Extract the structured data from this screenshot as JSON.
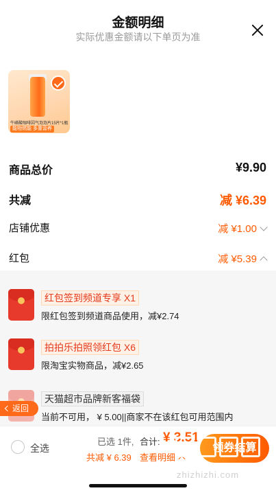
{
  "header": {
    "title": "金额明细",
    "subtitle": "实际优惠金额请以下单页为准"
  },
  "product": {
    "caption": "牛磺酸咖啡因气泡泡片15片*1瓶",
    "tag": "能物燃能 多重营养",
    "selected": true
  },
  "summary": {
    "total_label": "商品总价",
    "total_value": "¥9.90",
    "reduce_label": "共减",
    "reduce_value": "减 ¥6.39",
    "shop_discount_label": "店铺优惠",
    "shop_discount_value": "减 ¥1.00",
    "red_packet_label": "红包",
    "red_packet_value": "减 ¥5.39"
  },
  "red_packets": [
    {
      "title": "红包签到频道专享 X1",
      "desc": "限红包签到频道商品使用，减¥2.74"
    },
    {
      "title": "拍拍乐拍照领红包 X6",
      "desc": "限淘宝实物商品，减¥2.65"
    },
    {
      "title": "天猫超市品牌新客福袋",
      "desc": "当前不可用， ¥ 5.00||商家不在该红包可用范围内"
    }
  ],
  "back_button": "返回",
  "bottom_bar": {
    "select_all": "全选",
    "selected_count": "已选 1件,",
    "total_label": "合计:",
    "total_amount": "¥ 3.51",
    "reduce": "共减 ¥ 6.39",
    "view_detail": "查看明细",
    "pay_button": "领券结算"
  },
  "watermark": {
    "text": "zhizhizhi.com"
  },
  "colors": {
    "accent": "#ff5a00",
    "red_packet": "#e83a2c",
    "panel_bg": "#f6f6f6"
  }
}
